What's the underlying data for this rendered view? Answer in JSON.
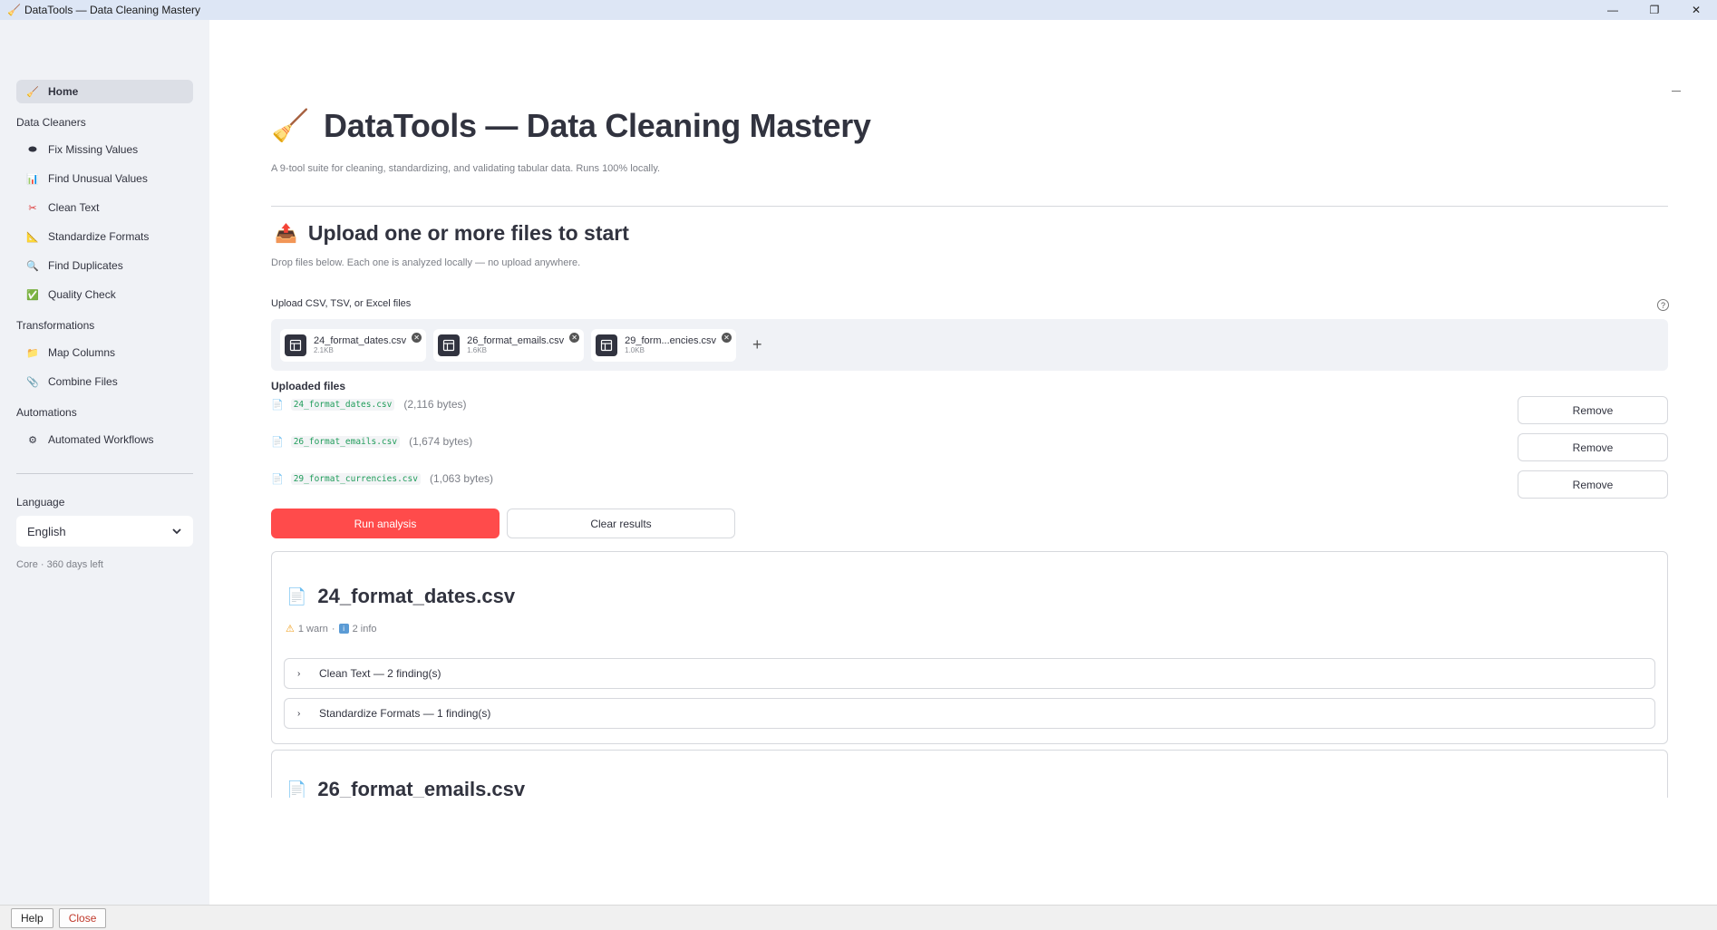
{
  "window": {
    "title": "DataTools — Data Cleaning Mastery",
    "controls": [
      "—",
      "❐",
      "✕"
    ]
  },
  "sidebar": {
    "home": {
      "label": "Home",
      "icon": "broom-icon"
    },
    "sections": [
      {
        "title": "Data Cleaners",
        "items": [
          {
            "label": "Fix Missing Values",
            "icon": "hole-icon"
          },
          {
            "label": "Find Unusual Values",
            "icon": "bar-chart-icon"
          },
          {
            "label": "Clean Text",
            "icon": "scissors-icon"
          },
          {
            "label": "Standardize Formats",
            "icon": "ruler-icon"
          },
          {
            "label": "Find Duplicates",
            "icon": "magnifier-icon"
          },
          {
            "label": "Quality Check",
            "icon": "check-box-icon"
          }
        ]
      },
      {
        "title": "Transformations",
        "items": [
          {
            "label": "Map Columns",
            "icon": "folder-icon"
          },
          {
            "label": "Combine Files",
            "icon": "paperclip-icon"
          }
        ]
      },
      {
        "title": "Automations",
        "items": [
          {
            "label": "Automated Workflows",
            "icon": "gear-icon"
          }
        ]
      }
    ],
    "language_label": "Language",
    "language_value": "English",
    "plan_note": "Core · 360 days left"
  },
  "main": {
    "title": "DataTools — Data Cleaning Mastery",
    "subtitle": "A 9-tool suite for cleaning, standardizing, and validating tabular data. Runs 100% locally.",
    "upload_section": {
      "title": "Upload one or more files to start",
      "subtitle": "Drop files below. Each one is analyzed locally — no upload anywhere.",
      "uploader_label": "Upload CSV, TSV, or Excel files",
      "chips": [
        {
          "name": "24_format_dates.csv",
          "size": "2.1KB"
        },
        {
          "name": "26_format_emails.csv",
          "size": "1.6KB"
        },
        {
          "name": "29_form...encies.csv",
          "size": "1.0KB"
        }
      ],
      "add_symbol": "+"
    },
    "uploaded": {
      "title": "Uploaded files",
      "files": [
        {
          "name": "24_format_dates.csv",
          "bytes": "(2,116 bytes)"
        },
        {
          "name": "26_format_emails.csv",
          "bytes": "(1,674 bytes)"
        },
        {
          "name": "29_format_currencies.csv",
          "bytes": "(1,063 bytes)"
        }
      ],
      "remove_label": "Remove"
    },
    "actions": {
      "run": "Run analysis",
      "clear": "Clear results"
    },
    "results": [
      {
        "file": "24_format_dates.csv",
        "warn": "1 warn",
        "sep": "·",
        "info": "2 info",
        "expanders": [
          "Clean Text — 2 finding(s)",
          "Standardize Formats — 1 finding(s)"
        ]
      },
      {
        "file": "26_format_emails.csv"
      }
    ]
  },
  "bottombar": {
    "help": "Help",
    "close": "Close"
  }
}
